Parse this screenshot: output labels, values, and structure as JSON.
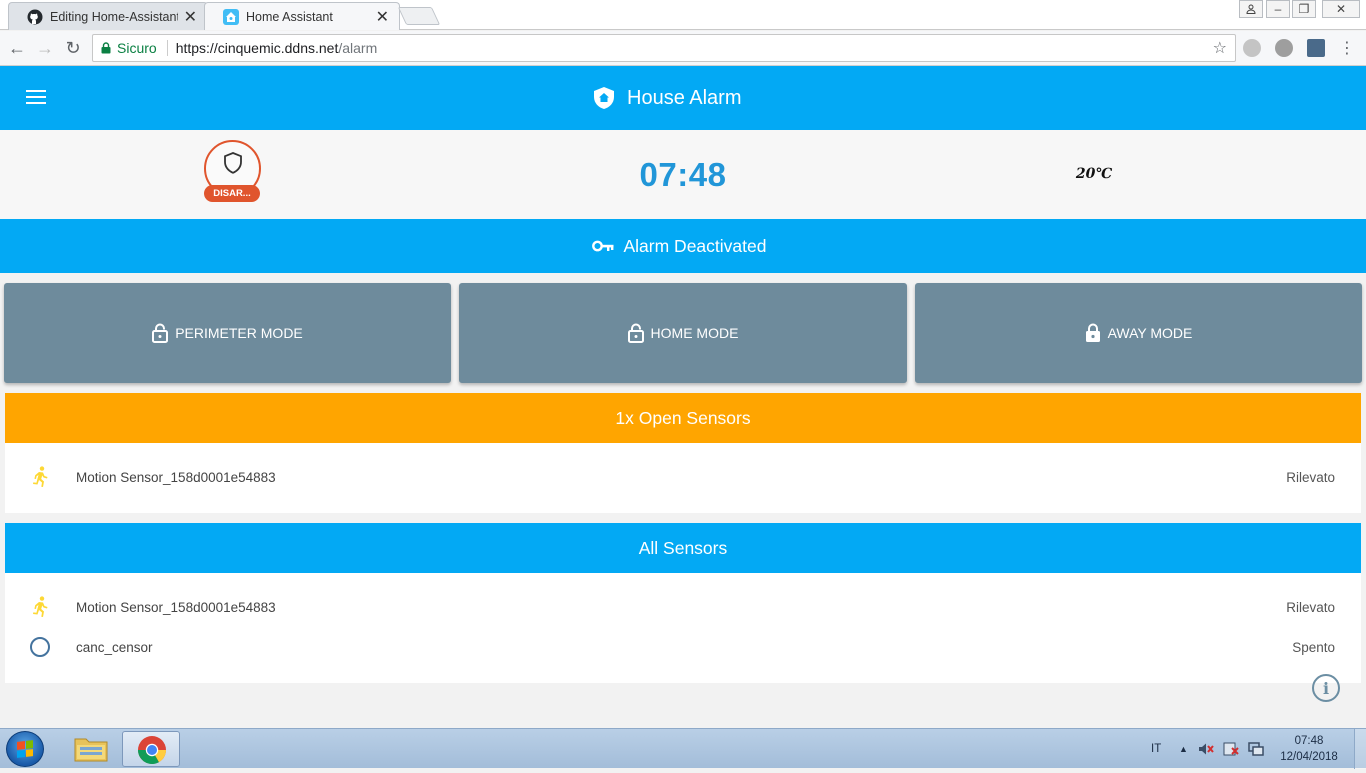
{
  "browser": {
    "tabs": [
      {
        "title": "Editing Home-AssistantC",
        "icon": "github-icon"
      },
      {
        "title": "Home Assistant",
        "icon": "home-assistant-icon"
      }
    ],
    "secure_label": "Sicuro",
    "url_host": "https://cinquemic.ddns.net",
    "url_path": "/alarm"
  },
  "app": {
    "title": "House Alarm",
    "header_color": "#03a9f4"
  },
  "status": {
    "badge_label": "DISAR...",
    "badge_color": "#e0552d",
    "time": "07:48",
    "temperature": "20℃"
  },
  "alarm": {
    "state_text": "Alarm Deactivated"
  },
  "modes": [
    {
      "label": "PERIMETER MODE",
      "icon": "lock-open-icon"
    },
    {
      "label": "HOME MODE",
      "icon": "lock-open-icon"
    },
    {
      "label": "AWAY MODE",
      "icon": "lock-closed-icon"
    }
  ],
  "open_sensors": {
    "title": "1x Open Sensors",
    "color": "#ffa500",
    "items": [
      {
        "name": "Motion Sensor_158d0001e54883",
        "state": "Rilevato",
        "icon": "run-icon"
      }
    ]
  },
  "all_sensors": {
    "title": "All Sensors",
    "items": [
      {
        "name": "Motion Sensor_158d0001e54883",
        "state": "Rilevato",
        "icon": "run-icon"
      },
      {
        "name": "canc_censor",
        "state": "Spento",
        "icon": "circle-outline-icon"
      }
    ]
  },
  "taskbar": {
    "language": "IT",
    "time": "07:48",
    "date": "12/04/2018"
  }
}
